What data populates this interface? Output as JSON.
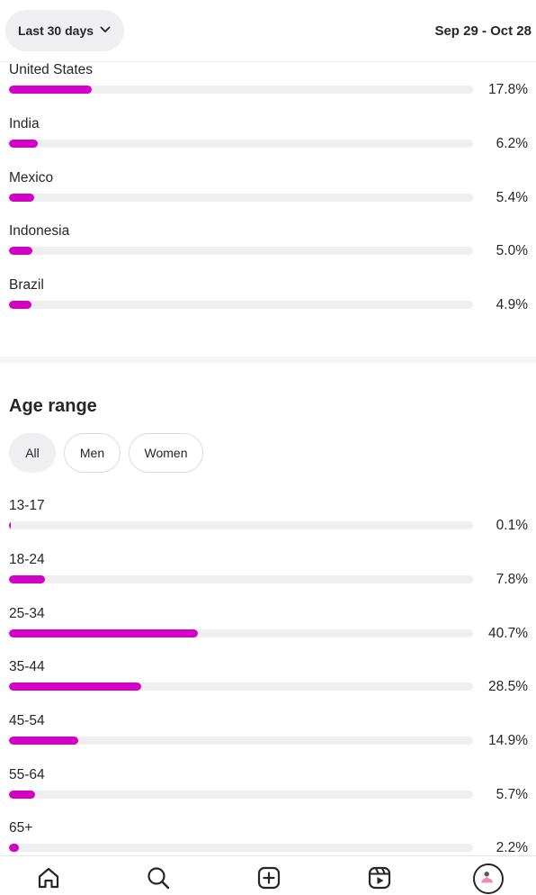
{
  "header": {
    "range_label": "Last 30 days",
    "date_range": "Sep 29 - Oct 28"
  },
  "countries": [
    {
      "label": "United States",
      "pct": "17.8%",
      "value": 17.8
    },
    {
      "label": "India",
      "pct": "6.2%",
      "value": 6.2
    },
    {
      "label": "Mexico",
      "pct": "5.4%",
      "value": 5.4
    },
    {
      "label": "Indonesia",
      "pct": "5.0%",
      "value": 5.0
    },
    {
      "label": "Brazil",
      "pct": "4.9%",
      "value": 4.9
    }
  ],
  "age_section": {
    "title": "Age range",
    "filters": [
      {
        "label": "All",
        "active": true
      },
      {
        "label": "Men",
        "active": false
      },
      {
        "label": "Women",
        "active": false
      }
    ],
    "rows": [
      {
        "label": "13-17",
        "pct": "0.1%",
        "value": 0.1
      },
      {
        "label": "18-24",
        "pct": "7.8%",
        "value": 7.8
      },
      {
        "label": "25-34",
        "pct": "40.7%",
        "value": 40.7
      },
      {
        "label": "35-44",
        "pct": "28.5%",
        "value": 28.5
      },
      {
        "label": "45-54",
        "pct": "14.9%",
        "value": 14.9
      },
      {
        "label": "55-64",
        "pct": "5.7%",
        "value": 5.7
      },
      {
        "label": "65+",
        "pct": "2.2%",
        "value": 2.2
      }
    ]
  },
  "nav": [
    "home-icon",
    "search-icon",
    "create-icon",
    "reels-icon",
    "profile-avatar"
  ],
  "colors": {
    "accent": "#d300c5",
    "track": "#efeff1",
    "text": "#262626"
  }
}
